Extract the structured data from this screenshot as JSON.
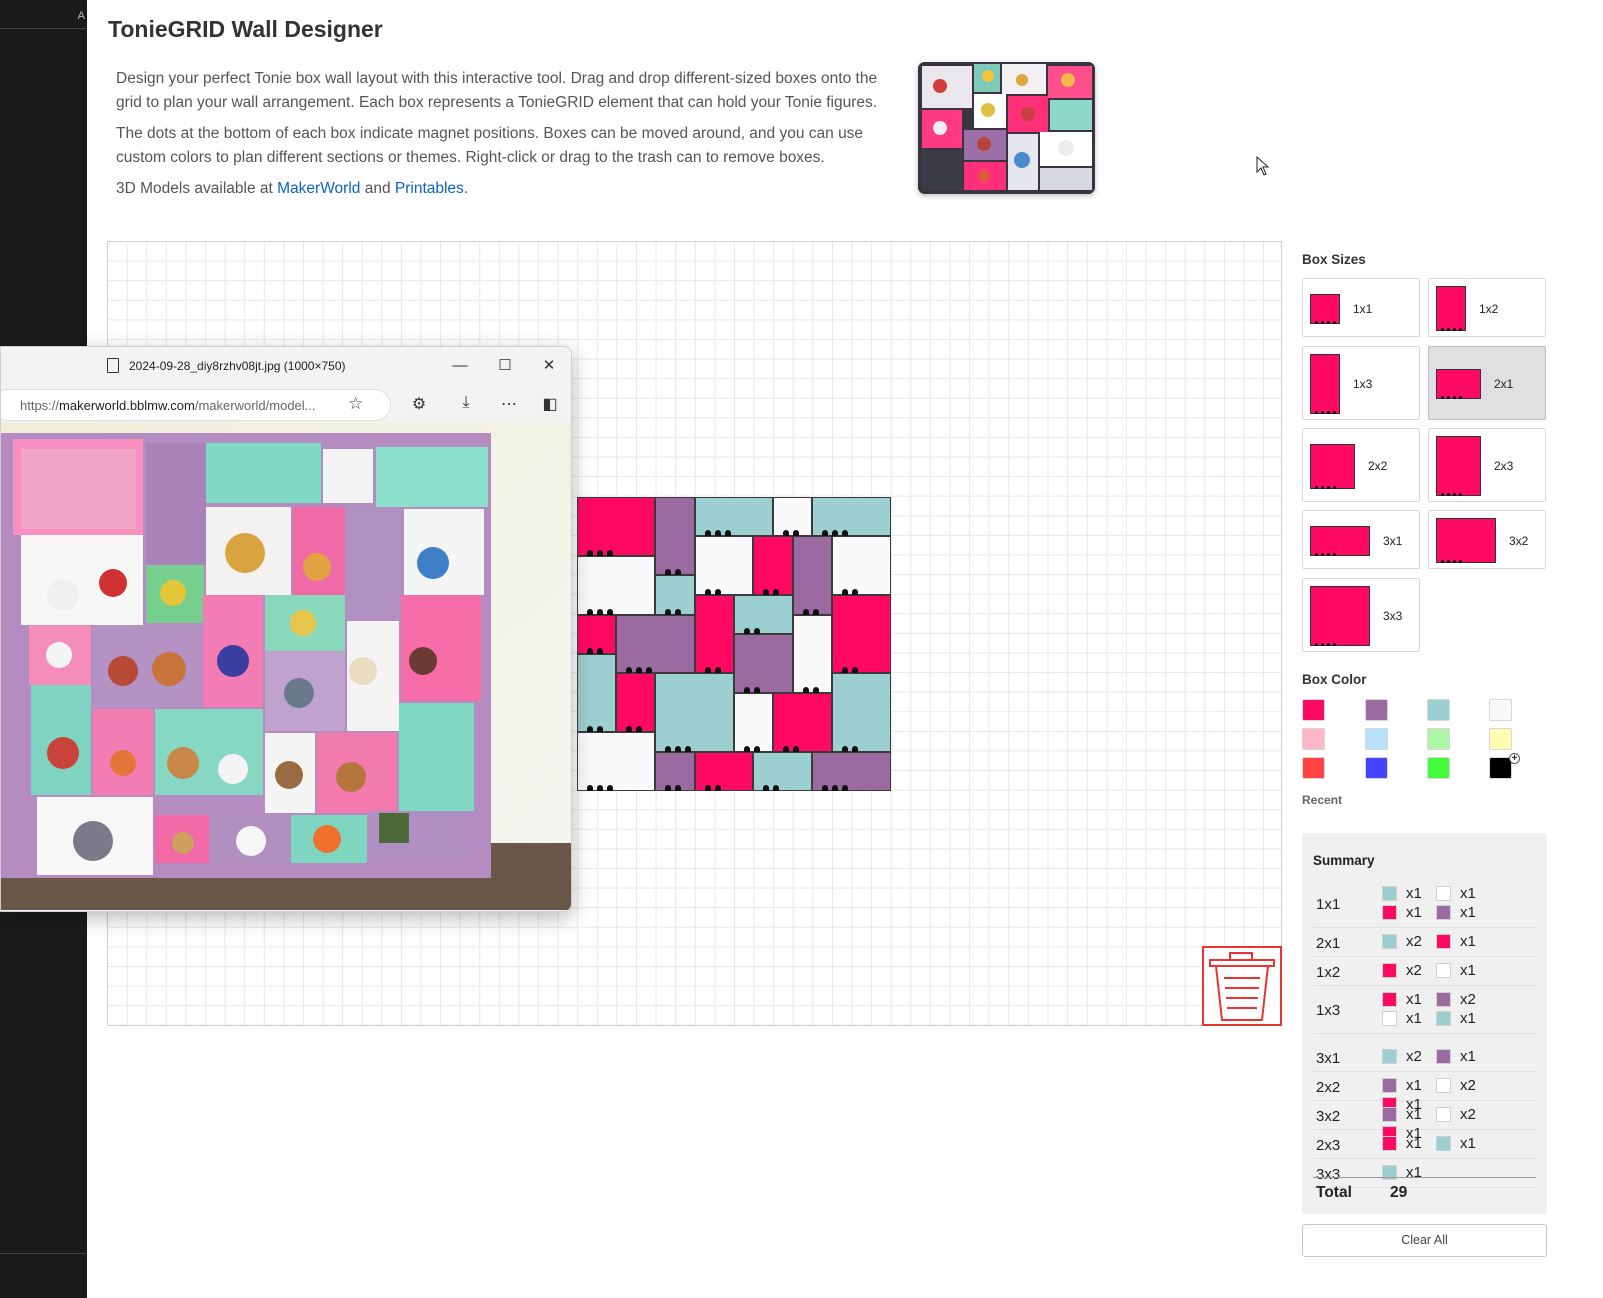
{
  "page": {
    "title": "TonieGRID Wall Designer",
    "para1": "Design your perfect Tonie box wall layout with this interactive tool. Drag and drop different-sized boxes onto the grid to plan your wall arrangement. Each box represents a TonieGRID element that can hold your Tonie figures.",
    "para2": "The dots at the bottom of each box indicate magnet positions. Boxes can be moved around, and you can use custom colors to plan different sections or themes. Right-click or drag to the trash can to remove boxes.",
    "models_prefix": "3D Models available at ",
    "link1": "MakerWorld",
    "and": " and ",
    "link2": "Printables",
    "period": "."
  },
  "left_strip": {
    "tab_letter": "A"
  },
  "viewer": {
    "window_title": "2024-09-28_diy8rzhv08jt.jpg (1000×750)",
    "url_prefix": "https://",
    "url_domain": "makerworld.bblmw.com",
    "url_rest": "/makerworld/model...",
    "minimize": "—",
    "maximize": "☐",
    "close": "✕"
  },
  "panel": {
    "sizes_title": "Box Sizes",
    "sizes": [
      {
        "label": "1x1",
        "selected": false
      },
      {
        "label": "1x2",
        "selected": false
      },
      {
        "label": "1x3",
        "selected": false
      },
      {
        "label": "2x1",
        "selected": true
      },
      {
        "label": "2x2",
        "selected": false
      },
      {
        "label": "2x3",
        "selected": false
      },
      {
        "label": "3x1",
        "selected": false
      },
      {
        "label": "3x2",
        "selected": false
      },
      {
        "label": "3x3",
        "selected": false
      }
    ],
    "color_title": "Box Color",
    "colors": [
      "#ff0a63",
      "#9b6aa0",
      "#9ccfcf",
      "#f8f8fa",
      "#ffb6c6",
      "#b8e0fa",
      "#aef7a6",
      "#fffdb0",
      "#ff4343",
      "#4444fc",
      "#44fb3c",
      "#000000"
    ],
    "plus": "+",
    "recent": "Recent",
    "clear": "Clear All"
  },
  "summary": {
    "title": "Summary",
    "rows": [
      {
        "size": "1x1",
        "items": [
          {
            "color": "#9ccfcf",
            "count": "x1"
          },
          {
            "color": "#ffffff",
            "count": "x1"
          },
          {
            "color": "#ff0a63",
            "count": "x1"
          },
          {
            "color": "#9b6aa0",
            "count": "x1"
          }
        ]
      },
      {
        "size": "2x1",
        "items": [
          {
            "color": "#9ccfcf",
            "count": "x2"
          },
          {
            "color": "#ff0a63",
            "count": "x1"
          }
        ]
      },
      {
        "size": "1x2",
        "items": [
          {
            "color": "#ff0a63",
            "count": "x2"
          },
          {
            "color": "#ffffff",
            "count": "x1"
          }
        ]
      },
      {
        "size": "1x3",
        "items": [
          {
            "color": "#ff0a63",
            "count": "x1"
          },
          {
            "color": "#9b6aa0",
            "count": "x2"
          },
          {
            "color": "#ffffff",
            "count": "x1"
          },
          {
            "color": "#9ccfcf",
            "count": "x1"
          }
        ]
      },
      {
        "size": "3x1",
        "items": [
          {
            "color": "#9ccfcf",
            "count": "x2"
          },
          {
            "color": "#9b6aa0",
            "count": "x1"
          }
        ]
      },
      {
        "size": "2x2",
        "items": [
          {
            "color": "#9b6aa0",
            "count": "x1"
          },
          {
            "color": "#ffffff",
            "count": "x2"
          },
          {
            "color": "#ff0a63",
            "count": "x1"
          }
        ]
      },
      {
        "size": "3x2",
        "items": [
          {
            "color": "#9b6aa0",
            "count": "x1"
          },
          {
            "color": "#ffffff",
            "count": "x2"
          },
          {
            "color": "#ff0a63",
            "count": "x1"
          }
        ]
      },
      {
        "size": "2x3",
        "items": [
          {
            "color": "#ff0a63",
            "count": "x1"
          },
          {
            "color": "#9ccfcf",
            "count": "x1"
          }
        ]
      },
      {
        "size": "3x3",
        "items": [
          {
            "color": "#9ccfcf",
            "count": "x1"
          }
        ]
      }
    ],
    "total_label": "Total",
    "total_value": "29"
  },
  "wall_boxes": [
    {
      "c": 0,
      "r": 0,
      "w": 4,
      "h": 3,
      "color": "#ff0a63"
    },
    {
      "c": 4,
      "r": 0,
      "w": 2,
      "h": 4,
      "color": "#9b6aa0"
    },
    {
      "c": 6,
      "r": 0,
      "w": 4,
      "h": 2,
      "color": "#9ccfcf"
    },
    {
      "c": 10,
      "r": 0,
      "w": 2,
      "h": 2,
      "color": "#fafafc"
    },
    {
      "c": 12,
      "r": 0,
      "w": 4,
      "h": 2,
      "color": "#9ccfcf"
    },
    {
      "c": 0,
      "r": 3,
      "w": 4,
      "h": 3,
      "color": "#fafafc"
    },
    {
      "c": 6,
      "r": 2,
      "w": 3,
      "h": 3,
      "color": "#fafafc"
    },
    {
      "c": 9,
      "r": 2,
      "w": 2,
      "h": 3,
      "color": "#ff0a63"
    },
    {
      "c": 11,
      "r": 2,
      "w": 2,
      "h": 4,
      "color": "#9b6aa0"
    },
    {
      "c": 13,
      "r": 2,
      "w": 3,
      "h": 3,
      "color": "#fafafc"
    },
    {
      "c": 4,
      "r": 4,
      "w": 2,
      "h": 2,
      "color": "#9ccfcf"
    },
    {
      "c": 0,
      "r": 6,
      "w": 2,
      "h": 2,
      "color": "#ff0a63"
    },
    {
      "c": 2,
      "r": 6,
      "w": 4,
      "h": 3,
      "color": "#9b6aa0"
    },
    {
      "c": 6,
      "r": 5,
      "w": 2,
      "h": 4,
      "color": "#ff0a63"
    },
    {
      "c": 8,
      "r": 5,
      "w": 3,
      "h": 2,
      "color": "#9ccfcf"
    },
    {
      "c": 8,
      "r": 7,
      "w": 3,
      "h": 3,
      "color": "#9b6aa0"
    },
    {
      "c": 11,
      "r": 6,
      "w": 2,
      "h": 4,
      "color": "#fafafc"
    },
    {
      "c": 13,
      "r": 5,
      "w": 3,
      "h": 4,
      "color": "#ff0a63"
    },
    {
      "c": 0,
      "r": 8,
      "w": 2,
      "h": 4,
      "color": "#9ccfcf"
    },
    {
      "c": 2,
      "r": 9,
      "w": 2,
      "h": 3,
      "color": "#ff0a63"
    },
    {
      "c": 4,
      "r": 9,
      "w": 4,
      "h": 4,
      "color": "#9ccfcf"
    },
    {
      "c": 8,
      "r": 10,
      "w": 2,
      "h": 3,
      "color": "#fafafc"
    },
    {
      "c": 10,
      "r": 10,
      "w": 3,
      "h": 3,
      "color": "#ff0a63"
    },
    {
      "c": 13,
      "r": 9,
      "w": 3,
      "h": 4,
      "color": "#9ccfcf"
    },
    {
      "c": 0,
      "r": 12,
      "w": 4,
      "h": 3,
      "color": "#fafafc"
    },
    {
      "c": 4,
      "r": 13,
      "w": 2,
      "h": 2,
      "color": "#9b6aa0"
    },
    {
      "c": 6,
      "r": 13,
      "w": 3,
      "h": 2,
      "color": "#ff0a63"
    },
    {
      "c": 9,
      "r": 13,
      "w": 3,
      "h": 2,
      "color": "#9ccfcf"
    },
    {
      "c": 12,
      "r": 13,
      "w": 4,
      "h": 2,
      "color": "#9b6aa0"
    }
  ]
}
